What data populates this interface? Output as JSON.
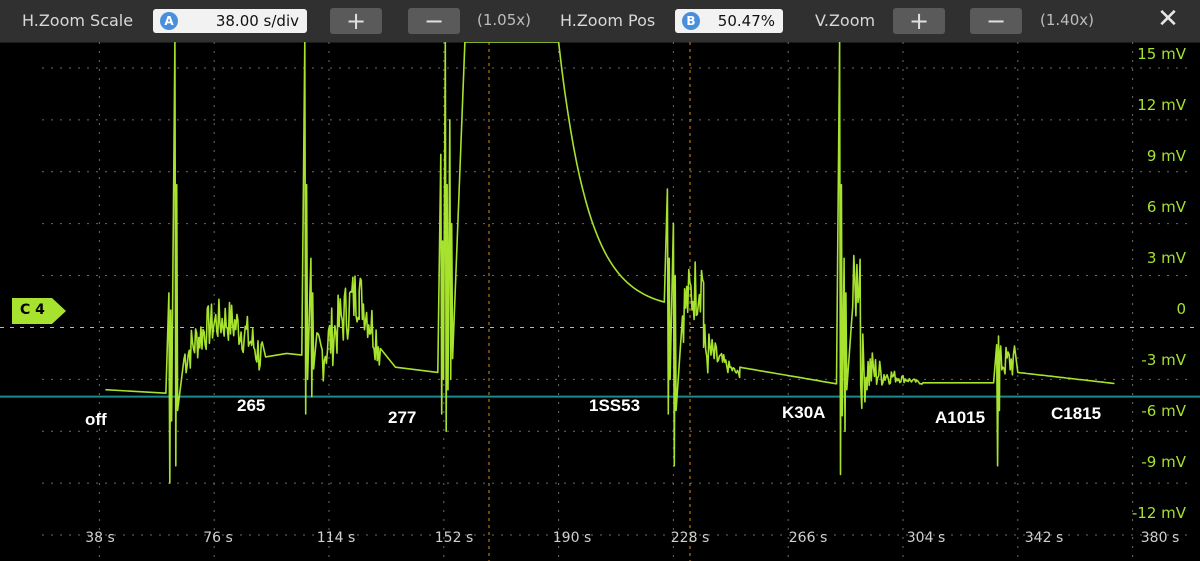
{
  "toolbar": {
    "hzoom_scale_label": "H.Zoom Scale",
    "hzoom_scale_badge": "A",
    "hzoom_scale_value": "38.00 s/div",
    "hzoom_plus": "+",
    "hzoom_minus": "−",
    "hzoom_factor": "(1.05x)",
    "hzoom_pos_label": "H.Zoom Pos",
    "hzoom_pos_badge": "B",
    "hzoom_pos_value": "50.47%",
    "vzoom_label": "V.Zoom",
    "vzoom_plus": "+",
    "vzoom_minus": "−",
    "vzoom_factor": "(1.40x)",
    "close": "✕"
  },
  "channel_marker": "C 4",
  "colors": {
    "trace": "#a6e22e",
    "cursor_line": "#1a8a8f",
    "grid": "#6a6a6a",
    "marker_orange": "#d88a1a"
  },
  "annotations": [
    "off",
    "265",
    "277",
    "1SS53",
    "K30A",
    "A1015",
    "C1815"
  ],
  "chart_data": {
    "type": "line",
    "y_tick_labels": [
      "15 mV",
      "12 mV",
      "9 mV",
      "6 mV",
      "3 mV",
      "0",
      "-3 mV",
      "-6 mV",
      "-9 mV",
      "-12 mV"
    ],
    "x_tick_labels": [
      "38 s",
      "76 s",
      "114 s",
      "152 s",
      "190 s",
      "228 s",
      "266 s",
      "304 s",
      "342 s",
      "380 s"
    ],
    "ylim": [
      -13.5,
      16.5
    ],
    "xlim": [
      19,
      399
    ],
    "grid": true,
    "cursor_level_mv": -4
  }
}
